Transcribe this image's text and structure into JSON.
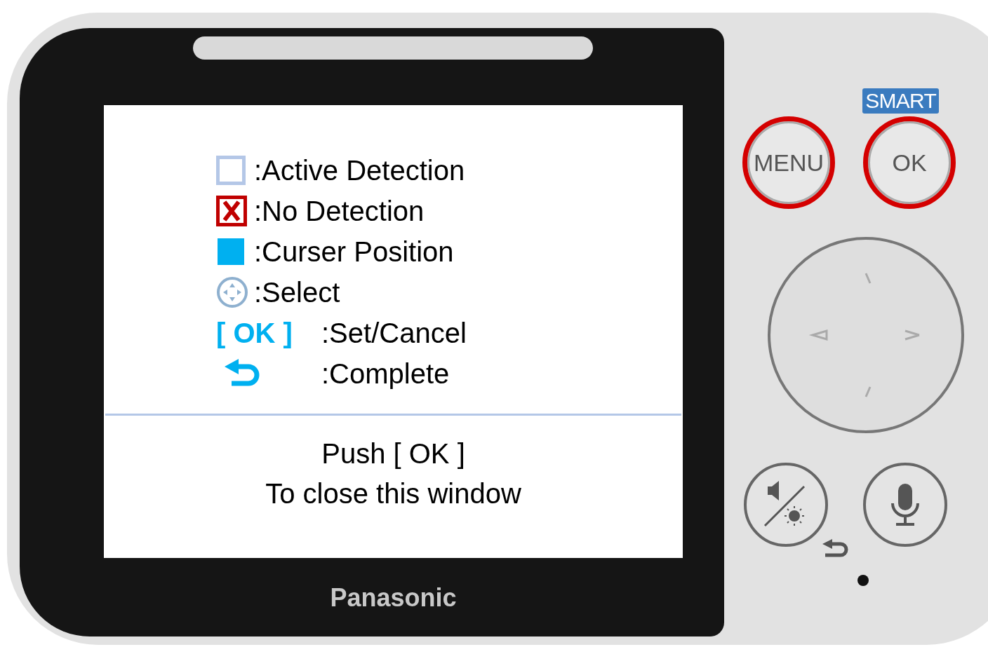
{
  "screen": {
    "legend": [
      {
        "kind": "active",
        "label": ":Active Detection"
      },
      {
        "kind": "none",
        "label": ":No Detection"
      },
      {
        "kind": "cursor",
        "label": ":Curser Position"
      },
      {
        "kind": "select",
        "label": ":Select"
      },
      {
        "kind": "ok",
        "key": "[ OK ]",
        "label": ":Set/Cancel"
      },
      {
        "kind": "back",
        "label": ":Complete"
      }
    ],
    "message": [
      "Push [ OK ]",
      "To close this window"
    ]
  },
  "device": {
    "brand": "Panasonic",
    "badge": "SMART",
    "buttons": [
      {
        "label": "MENU"
      },
      {
        "label": "OK"
      }
    ]
  }
}
